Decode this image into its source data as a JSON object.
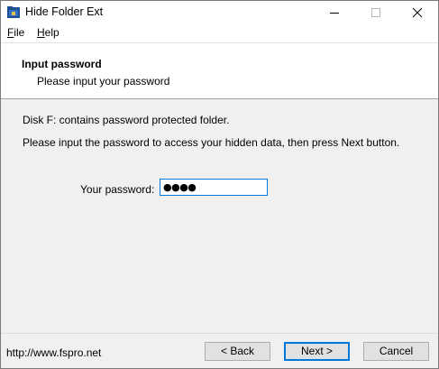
{
  "window": {
    "title": "Hide Folder Ext",
    "icon": "hide-folder-app-icon",
    "controls": [
      "minimize-icon",
      "maximize-icon",
      "close-icon"
    ]
  },
  "menu": {
    "file": {
      "hotkey": "F",
      "rest": "ile"
    },
    "help": {
      "hotkey": "H",
      "rest": "elp"
    }
  },
  "header": {
    "title": "Input password",
    "subtitle": "Please input your password"
  },
  "body": {
    "message_1": "Disk F: contains password protected folder.",
    "message_2": "Please input the password to access your hidden data, then press Next button.",
    "password_label": "Your password:",
    "password_value": "●●●●"
  },
  "footer": {
    "url": "http://www.fspro.net",
    "back_label": "< Back",
    "next_label": "Next >",
    "cancel_label": "Cancel"
  },
  "colors": {
    "accent": "#0078d7",
    "window_bg": "#f0f0f0",
    "header_bg": "#ffffff",
    "button_bg": "#e1e1e1"
  }
}
